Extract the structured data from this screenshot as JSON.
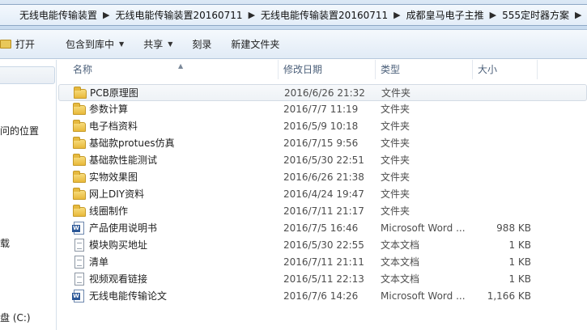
{
  "breadcrumbs": [
    "无线电能传输装置",
    "无线电能传输装置20160711",
    "无线电能传输装置20160711",
    "成都皇马电子主推",
    "555定时器方案"
  ],
  "toolbar": {
    "open_label": "打开",
    "include_label": "包含到库中",
    "share_label": "共享",
    "burn_label": "刻录",
    "new_folder_label": "新建文件夹"
  },
  "nav": {
    "item_recent": "问的位置",
    "item_download": "载",
    "item_disk_c": "盘 (C:)"
  },
  "columns": {
    "name": "名称",
    "date": "修改日期",
    "type": "类型",
    "size": "大小"
  },
  "files": [
    {
      "name": "PCB原理图",
      "date": "2016/6/26 21:32",
      "type": "文件夹",
      "size": "",
      "icon": "folder-icon",
      "selected": true
    },
    {
      "name": "参数计算",
      "date": "2016/7/7 11:19",
      "type": "文件夹",
      "size": "",
      "icon": "folder-icon"
    },
    {
      "name": "电子档资料",
      "date": "2016/5/9 10:18",
      "type": "文件夹",
      "size": "",
      "icon": "folder-icon"
    },
    {
      "name": "基础款protues仿真",
      "date": "2016/7/15 9:56",
      "type": "文件夹",
      "size": "",
      "icon": "folder-icon"
    },
    {
      "name": "基础款性能测试",
      "date": "2016/5/30 22:51",
      "type": "文件夹",
      "size": "",
      "icon": "folder-icon"
    },
    {
      "name": "实物效果图",
      "date": "2016/6/26 21:38",
      "type": "文件夹",
      "size": "",
      "icon": "folder-icon"
    },
    {
      "name": "网上DIY资料",
      "date": "2016/4/24 19:47",
      "type": "文件夹",
      "size": "",
      "icon": "folder-icon"
    },
    {
      "name": "线圈制作",
      "date": "2016/7/11 21:17",
      "type": "文件夹",
      "size": "",
      "icon": "folder-icon"
    },
    {
      "name": "产品使用说明书",
      "date": "2016/7/5 16:46",
      "type": "Microsoft Word ...",
      "size": "988 KB",
      "icon": "word-doc-icon"
    },
    {
      "name": "模块购买地址",
      "date": "2016/5/30 22:55",
      "type": "文本文档",
      "size": "1 KB",
      "icon": "text-doc-icon"
    },
    {
      "name": "清单",
      "date": "2016/7/11 21:11",
      "type": "文本文档",
      "size": "1 KB",
      "icon": "text-doc-icon"
    },
    {
      "name": "视频观看链接",
      "date": "2016/5/11 22:13",
      "type": "文本文档",
      "size": "1 KB",
      "icon": "text-doc-icon"
    },
    {
      "name": "无线电能传输论文",
      "date": "2016/7/6 14:26",
      "type": "Microsoft Word ...",
      "size": "1,166 KB",
      "icon": "word-doc-icon"
    }
  ]
}
